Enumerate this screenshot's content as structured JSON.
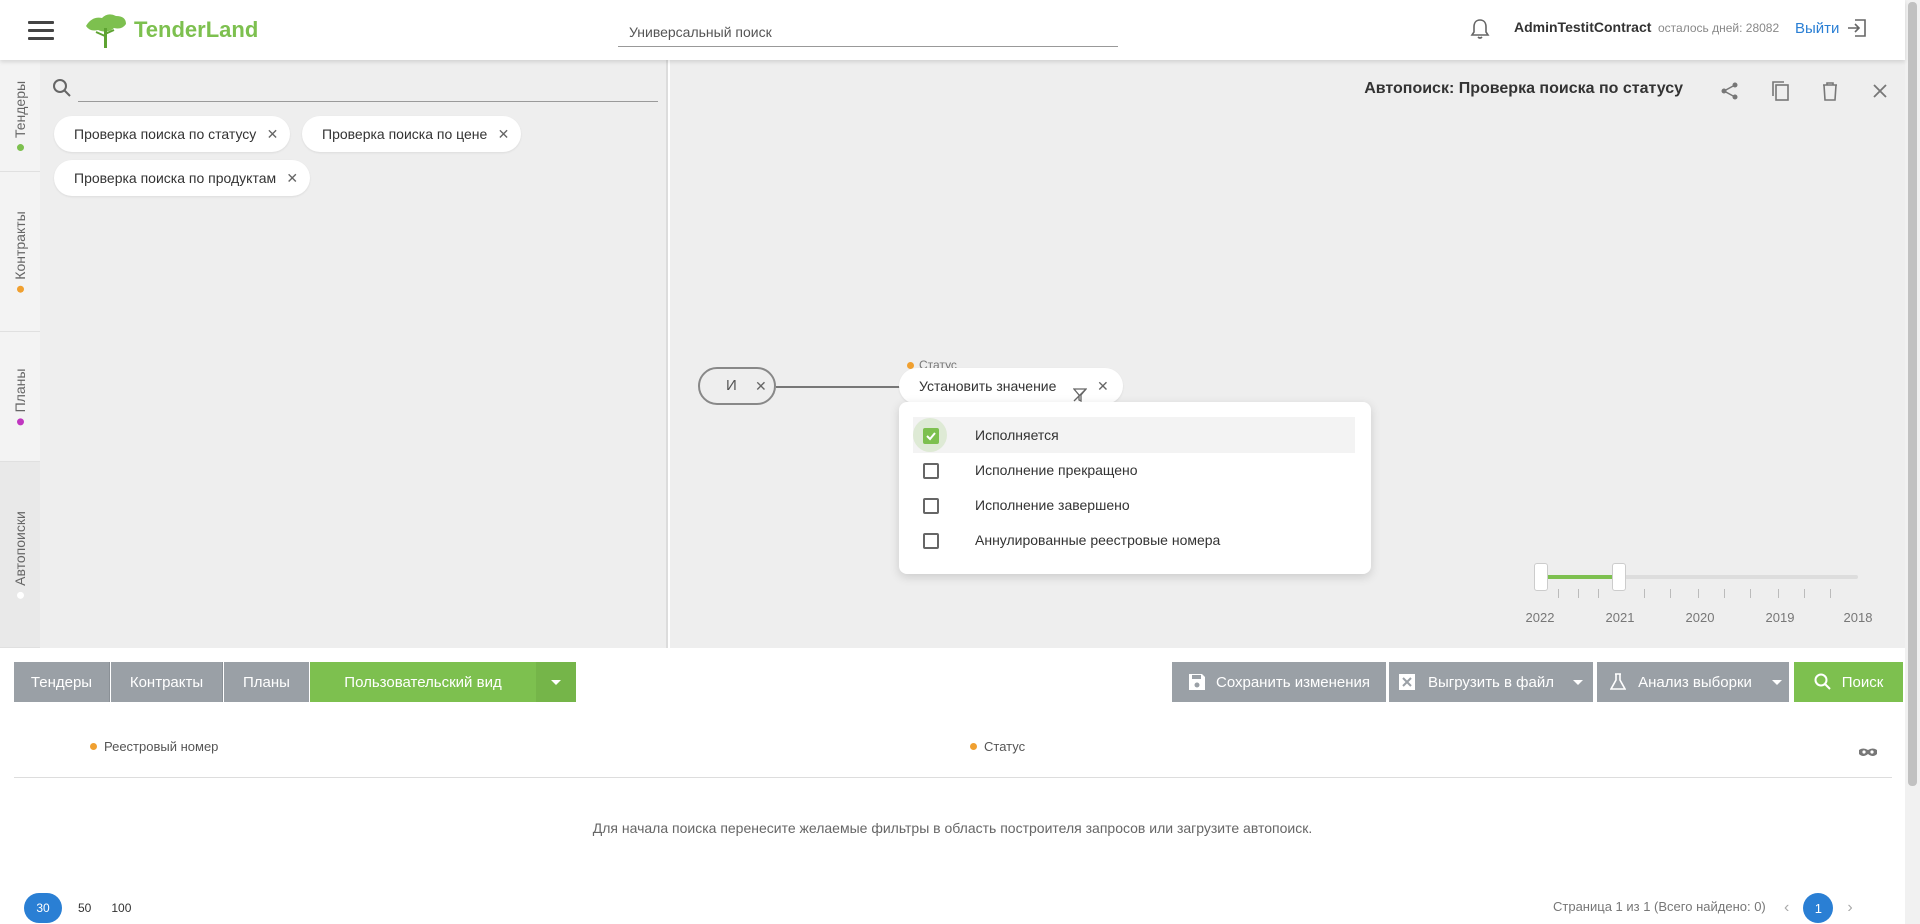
{
  "header": {
    "logo_text": "TenderLand",
    "search_placeholder": "Универсальный поиск",
    "username": "AdminTestitContract",
    "days_left": "осталось дней: 28082",
    "logout": "Выйти"
  },
  "side_tabs": [
    {
      "label": "Тендеры",
      "dot_color": "#7dc04f"
    },
    {
      "label": "Контракты",
      "dot_color": "#f0a030"
    },
    {
      "label": "Планы",
      "dot_color": "#c036c0"
    },
    {
      "label": "Автопоиски",
      "dot_color": "#ffffff"
    }
  ],
  "saved_searches": [
    "Проверка поиска по статусу",
    "Проверка поиска по цене",
    "Проверка поиска по продуктам"
  ],
  "autosearch": {
    "title": "Автопоиск: Проверка поиска по статусу"
  },
  "query": {
    "operator": "И",
    "field_label": "Статус",
    "value_label": "Установить значение",
    "options": [
      {
        "label": "Исполняется",
        "checked": true
      },
      {
        "label": "Исполнение прекращено",
        "checked": false
      },
      {
        "label": "Исполнение завершено",
        "checked": false
      },
      {
        "label": "Аннулированные реестровые номера",
        "checked": false
      }
    ]
  },
  "year_slider": {
    "years": [
      "2022",
      "2021",
      "2020",
      "2019",
      "2018"
    ],
    "range_from": "2022",
    "range_to": "2021"
  },
  "toolbar": {
    "tab_tenders": "Тендеры",
    "tab_contracts": "Контракты",
    "tab_plans": "Планы",
    "custom_view": "Пользовательский вид",
    "save_changes": "Сохранить изменения",
    "export_file": "Выгрузить в файл",
    "analyze": "Анализ выборки",
    "search": "Поиск"
  },
  "table": {
    "columns": [
      "Реестровый номер",
      "Статус"
    ],
    "empty_message": "Для начала поиска перенесите желаемые фильтры в область построителя запросов или загрузите автопоиск."
  },
  "pagination": {
    "sizes": [
      "30",
      "50",
      "100"
    ],
    "active_size": "30",
    "info": "Страница 1 из 1 (Всего найдено: 0)",
    "current_page": "1"
  },
  "colors": {
    "accent_green": "#7dc04f",
    "link_blue": "#2a7fd4",
    "button_gray": "#9aa0a6"
  }
}
